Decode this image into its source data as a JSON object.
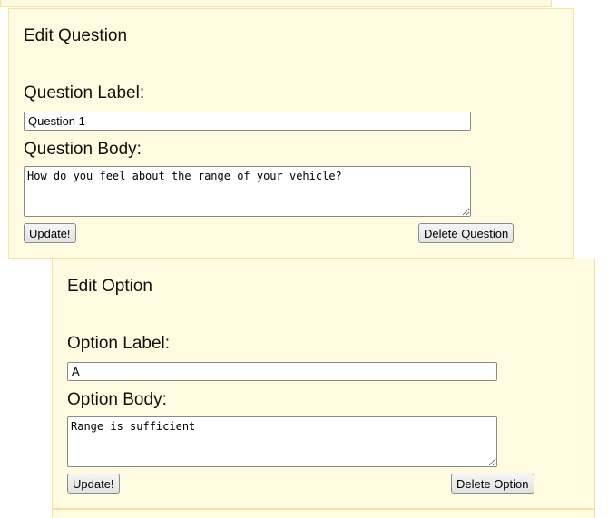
{
  "question_panel": {
    "title": "Edit Question",
    "label_caption": "Question Label:",
    "label_value": "Question 1",
    "body_caption": "Question Body:",
    "body_value": "How do you feel about the range of your vehicle?",
    "update_button": "Update!",
    "delete_button": "Delete Question"
  },
  "option_panel": {
    "title": "Edit Option",
    "label_caption": "Option Label:",
    "label_value": "A",
    "body_caption": "Option Body:",
    "body_value": "Range is sufficient",
    "update_button": "Update!",
    "delete_button": "Delete Option"
  },
  "colors": {
    "panel_background": "#fffbe0",
    "panel_border": "#f3e3a0"
  }
}
